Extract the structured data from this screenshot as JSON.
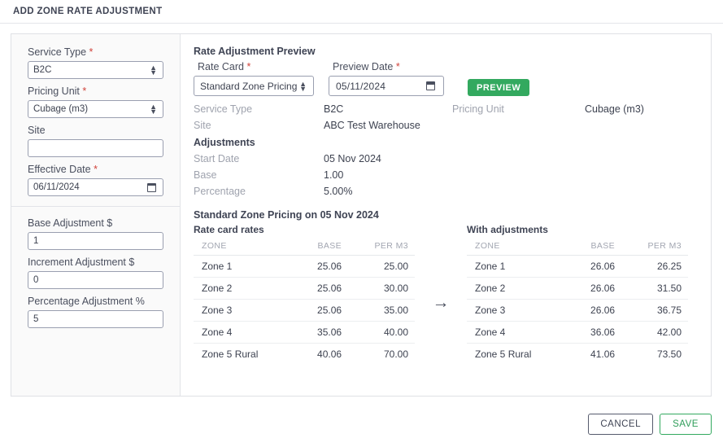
{
  "header": {
    "title": "ADD ZONE RATE ADJUSTMENT"
  },
  "sidebar": {
    "service_type": {
      "label": "Service Type",
      "required": "*",
      "value": "B2C"
    },
    "pricing_unit": {
      "label": "Pricing Unit",
      "required": "*",
      "value": "Cubage (m3)"
    },
    "site": {
      "label": "Site",
      "value": "",
      "placeholder": ""
    },
    "effective_date": {
      "label": "Effective Date",
      "required": "*",
      "value": "06/11/2024"
    },
    "base_adjustment": {
      "label": "Base Adjustment $",
      "value": "1"
    },
    "increment_adjustment": {
      "label": "Increment Adjustment $",
      "value": "0"
    },
    "percentage_adjustment": {
      "label": "Percentage Adjustment %",
      "value": "5"
    }
  },
  "preview": {
    "title": "Rate Adjustment Preview",
    "rate_card": {
      "label": "Rate Card",
      "required": "*",
      "value": "Standard Zone Pricing"
    },
    "preview_date": {
      "label": "Preview Date",
      "required": "*",
      "value": "05/11/2024"
    },
    "preview_button": "PREVIEW",
    "summary": [
      {
        "key": "Service Type",
        "value": "B2C",
        "key2": "Pricing Unit",
        "value2": "Cubage (m3)"
      },
      {
        "key": "Site",
        "value": "ABC Test Warehouse",
        "key2": "",
        "value2": ""
      }
    ],
    "adjustments_title": "Adjustments",
    "adjustments": [
      {
        "key": "Start Date",
        "value": "05 Nov 2024"
      },
      {
        "key": "Base",
        "value": "1.00"
      },
      {
        "key": "Percentage",
        "value": "5.00%"
      }
    ],
    "rate_heading": "Standard Zone Pricing on 05 Nov 2024",
    "arrow_icon": "→",
    "tables": [
      {
        "caption": "Rate card rates",
        "columns": [
          "ZONE",
          "BASE",
          "PER M3"
        ],
        "rows": [
          [
            "Zone 1",
            "25.06",
            "25.00"
          ],
          [
            "Zone 2",
            "25.06",
            "30.00"
          ],
          [
            "Zone 3",
            "25.06",
            "35.00"
          ],
          [
            "Zone 4",
            "35.06",
            "40.00"
          ],
          [
            "Zone 5 Rural",
            "40.06",
            "70.00"
          ]
        ]
      },
      {
        "caption": "With adjustments",
        "columns": [
          "ZONE",
          "BASE",
          "PER M3"
        ],
        "rows": [
          [
            "Zone 1",
            "26.06",
            "26.25"
          ],
          [
            "Zone 2",
            "26.06",
            "31.50"
          ],
          [
            "Zone 3",
            "26.06",
            "36.75"
          ],
          [
            "Zone 4",
            "36.06",
            "42.00"
          ],
          [
            "Zone 5 Rural",
            "41.06",
            "73.50"
          ]
        ]
      }
    ]
  },
  "footer": {
    "cancel_label": "CANCEL",
    "save_label": "SAVE"
  },
  "colors": {
    "accent_green": "#33a95f",
    "required_red": "#d0433b",
    "muted_text": "#9fa3ae",
    "body_text": "#3d4250"
  }
}
